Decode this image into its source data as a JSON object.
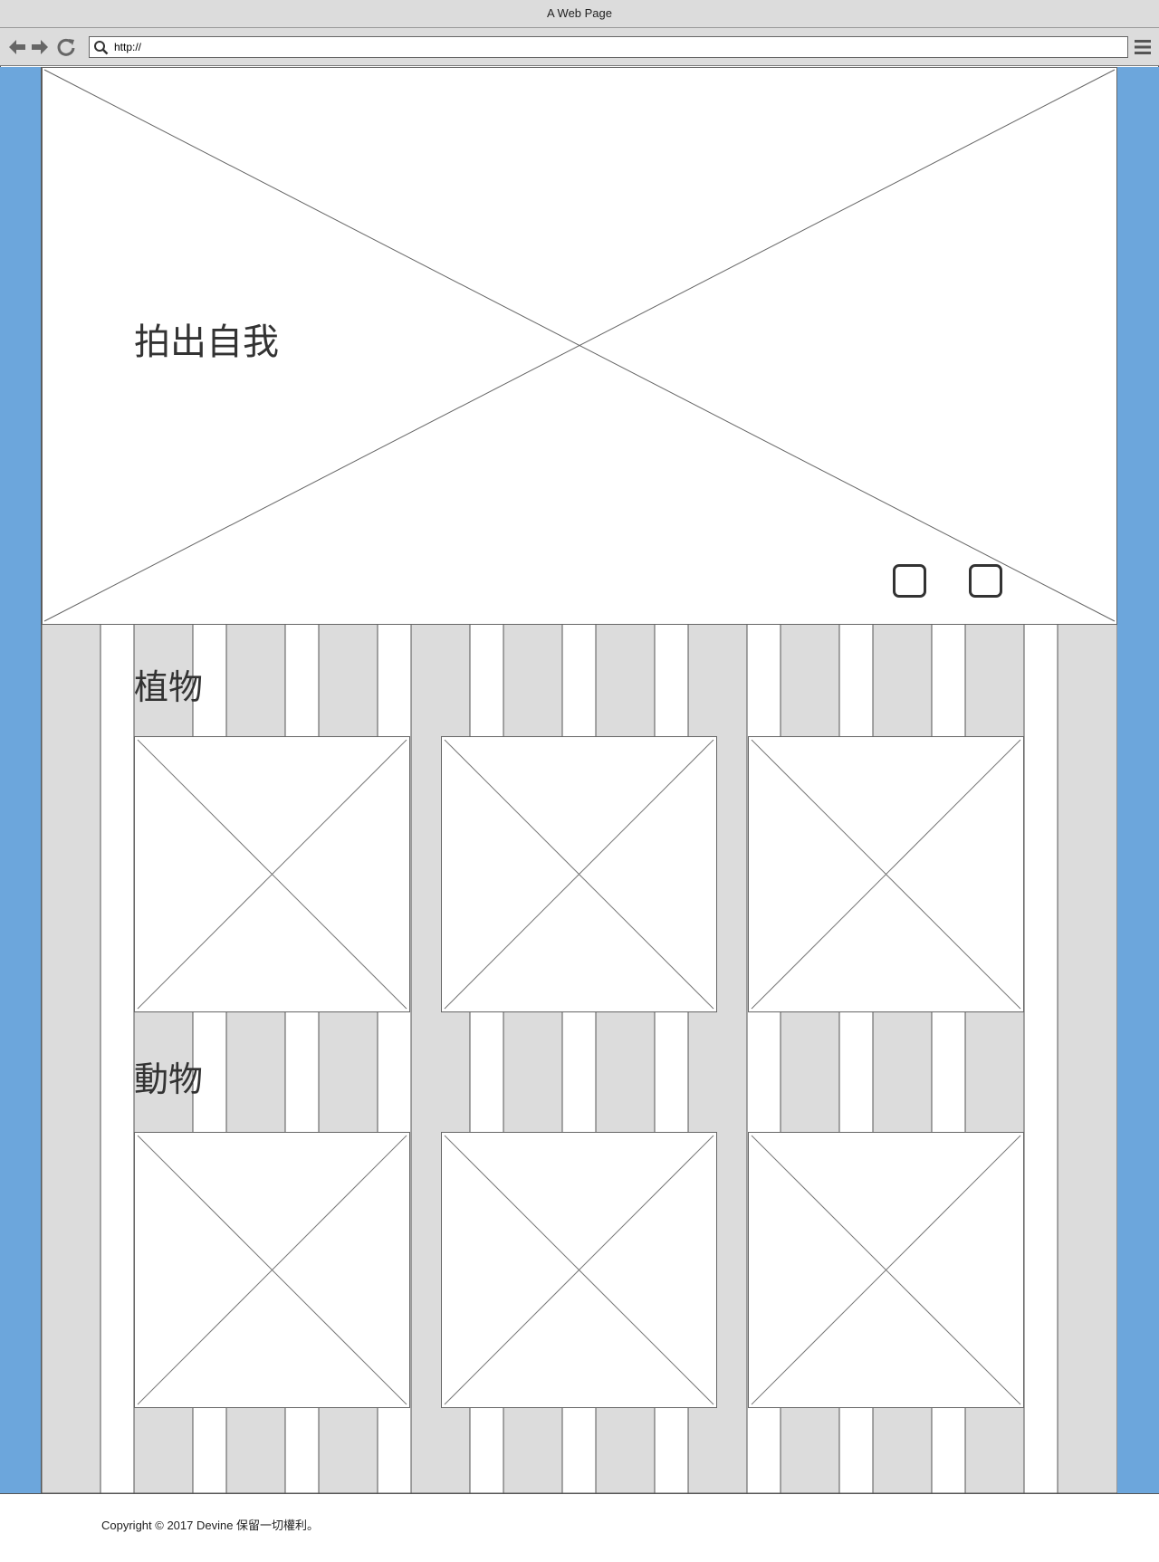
{
  "browser": {
    "title": "A Web Page",
    "url": "http://"
  },
  "hero": {
    "title": "拍出自我"
  },
  "sections": [
    {
      "title": "植物"
    },
    {
      "title": "動物"
    }
  ],
  "footer": {
    "copyright": "Copyright © 2017 Devine 保留一切權利。"
  },
  "colors": {
    "side_bar": "#6ca6dc",
    "grid_gray": "#dcdcdc",
    "placeholder_line": "#666666"
  }
}
